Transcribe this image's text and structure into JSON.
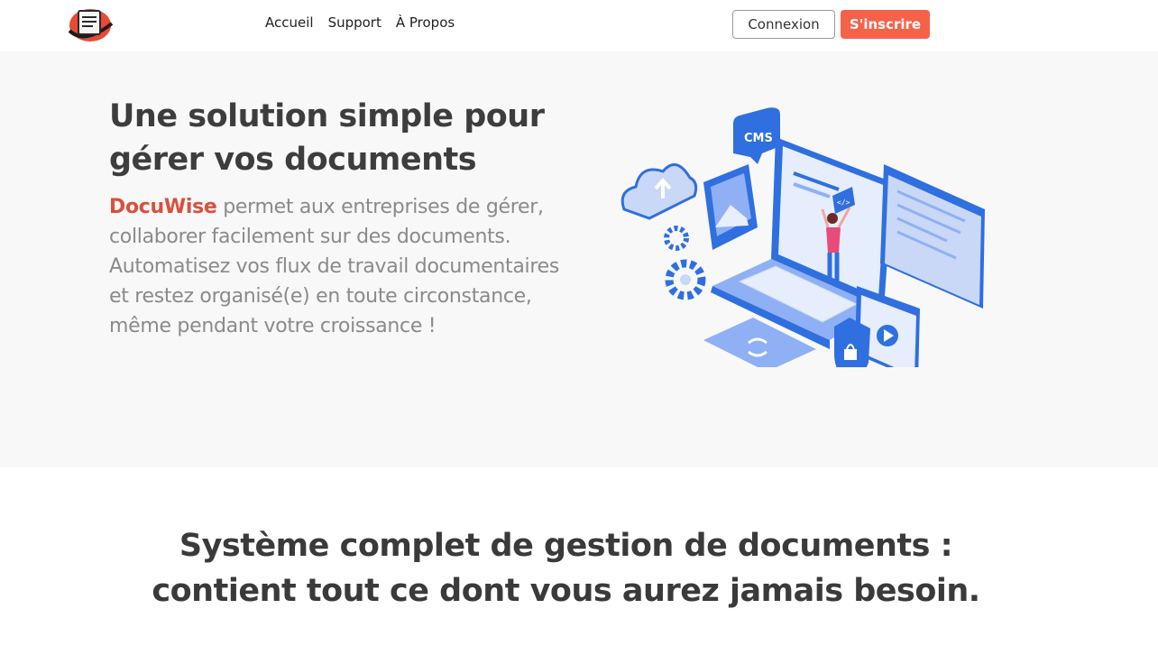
{
  "header": {
    "nav": [
      {
        "label": "Accueil"
      },
      {
        "label": "Support"
      },
      {
        "label": "À Propos"
      }
    ],
    "login_label": "Connexion",
    "signup_label": "S'inscrire"
  },
  "hero": {
    "title": "Une solution simple pour gérer vos documents",
    "brand": "DocuWise",
    "description": " permet aux entreprises de gérer, collaborer facilement sur des documents. Automatisez vos flux de travail documentaires et restez organisé(e) en toute circonstance, même pendant votre croissance !",
    "illustration_label": "CMS"
  },
  "section": {
    "title": "Système complet de gestion de documents : contient tout ce dont vous aurez jamais besoin."
  },
  "colors": {
    "accent": "#f4624a",
    "brand_text": "#d9503d",
    "illustration_blue": "#2f6fe0"
  }
}
